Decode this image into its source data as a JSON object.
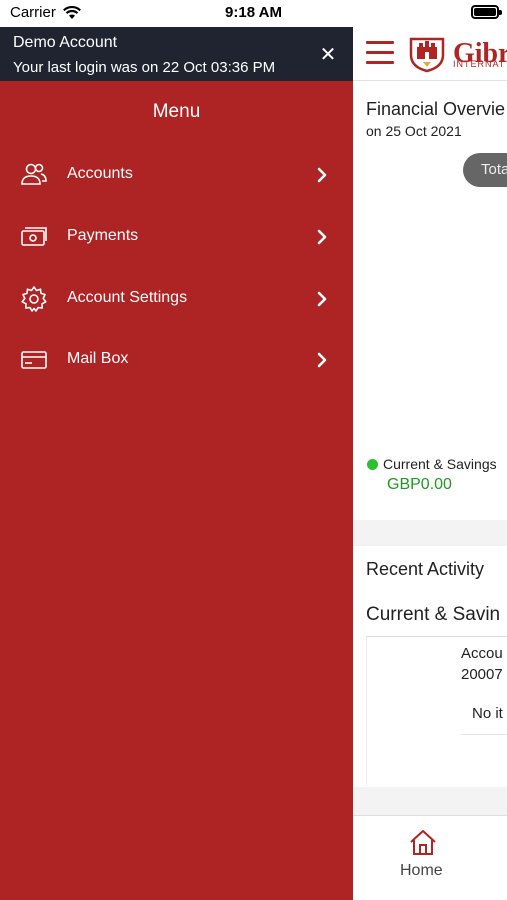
{
  "status_bar": {
    "carrier": "Carrier",
    "time": "9:18 AM"
  },
  "drawer": {
    "account_name": "Demo Account",
    "last_login": "Your last login was on 22 Oct 03:36 PM",
    "close_symbol": "✕",
    "menu_title": "Menu",
    "items": [
      {
        "label": "Accounts",
        "icon": "users-icon"
      },
      {
        "label": "Payments",
        "icon": "cash-icon"
      },
      {
        "label": "Account Settings",
        "icon": "gear-icon"
      },
      {
        "label": "Mail Box",
        "icon": "card-icon"
      }
    ]
  },
  "background_app": {
    "brand_text": "Gibr",
    "brand_sub": "INTERNAT",
    "financial_overview_title": "Financial Overvie",
    "financial_overview_date": "on 25 Oct 2021",
    "total_pill": "Tota",
    "legend_label": "Current & Savings",
    "legend_value": "GBP0.00",
    "recent_activity_title": "Recent Activity",
    "current_savings_title": "Current & Savin",
    "account_label": "Accou",
    "account_number": "20007",
    "no_items": "No it",
    "tab_home_label": "Home"
  },
  "colors": {
    "brand_red": "#ae2323",
    "header_dark": "#1f2430",
    "legend_green": "#2cc02c",
    "value_green": "#1f9a1f"
  }
}
